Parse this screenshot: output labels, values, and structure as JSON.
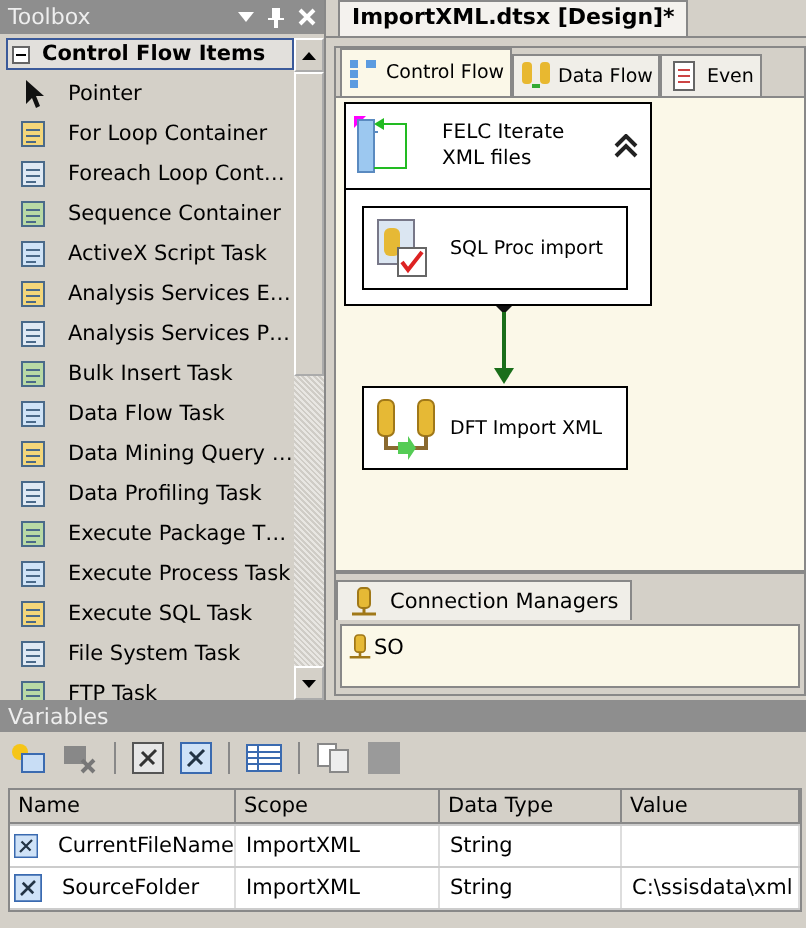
{
  "toolbox": {
    "title": "Toolbox",
    "section": {
      "label": "Control Flow Items",
      "expanded": true
    },
    "items": [
      "Pointer",
      "For Loop Container",
      "Foreach Loop Cont…",
      "Sequence Container",
      "ActiveX Script Task",
      "Analysis Services E…",
      "Analysis Services P…",
      "Bulk Insert Task",
      "Data Flow Task",
      "Data Mining Query …",
      "Data Profiling Task",
      "Execute Package T…",
      "Execute Process Task",
      "Execute SQL Task",
      "File System Task",
      "FTP Task"
    ]
  },
  "document_tab": {
    "title": "ImportXML.dtsx [Design]*"
  },
  "designer_tabs": [
    {
      "label": "Control Flow",
      "selected": true
    },
    {
      "label": "Data Flow",
      "selected": false
    },
    {
      "label": "Even",
      "selected": false
    }
  ],
  "canvas": {
    "container": {
      "title": "FELC Iterate XML files",
      "expanded": true,
      "tasks": [
        {
          "label": "SQL Proc import"
        }
      ]
    },
    "tasks": [
      {
        "label": "DFT Import XML"
      }
    ]
  },
  "connection_managers": {
    "tab": "Connection Managers",
    "items": [
      "SO"
    ]
  },
  "variables": {
    "title": "Variables",
    "columns": [
      "Name",
      "Scope",
      "Data Type",
      "Value"
    ],
    "rows": [
      [
        "CurrentFileName",
        "ImportXML",
        "String",
        ""
      ],
      [
        "SourceFolder",
        "ImportXML",
        "String",
        "C:\\ssisdata\\xml"
      ]
    ]
  }
}
